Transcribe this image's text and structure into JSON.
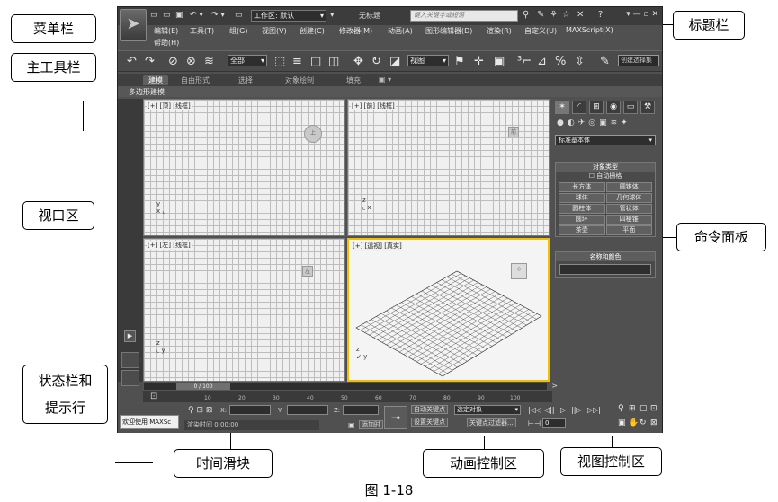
{
  "callouts": {
    "menubar": "菜单栏",
    "maintoolbar": "主工具栏",
    "viewport_area": "视口区",
    "status_line1": "状态栏和",
    "status_line2": "提示行",
    "titlebar": "标题栏",
    "command_panel": "命令面板",
    "time_slider": "时间滑块",
    "anim_controls": "动画控制区",
    "view_controls": "视图控制区"
  },
  "caption": "图 1-18",
  "titlebar": {
    "workspace": "工作区: 默认",
    "title": "无标题",
    "search_placeholder": "键入关键字或短语"
  },
  "menu": {
    "items": [
      "编辑(E)",
      "工具(T)",
      "组(G)",
      "视图(V)",
      "创建(C)",
      "修改器(M)",
      "动画(A)",
      "图形编辑器(D)",
      "渲染(R)",
      "自定义(U)",
      "MAXScript(X)"
    ],
    "help": "帮助(H)"
  },
  "toolbar": {
    "filter": "全部",
    "refcoord": "视图",
    "named_selection": "创建选择集"
  },
  "ribbon": {
    "tabs": [
      "建模",
      "自由形式",
      "选择",
      "对象绘制",
      "填充"
    ],
    "sub": "多边形建模"
  },
  "viewports": {
    "top": "[+] [顶] [线框]",
    "front": "[+] [前] [线框]",
    "left": "[+] [左] [线框]",
    "persp": "[+] [透视] [真实]"
  },
  "command_panel": {
    "dropdown": "标准基本体",
    "object_type_title": "对象类型",
    "autogrid": "☐ 自动栅格",
    "objects": [
      "长方体",
      "圆锥体",
      "球体",
      "几何球体",
      "圆柱体",
      "管状体",
      "圆环",
      "四棱锥",
      "茶壶",
      "平面"
    ],
    "name_color_title": "名称和颜色"
  },
  "timeline": {
    "slider": "0 / 100",
    "ticks": [
      "10",
      "20",
      "30",
      "40",
      "50",
      "60",
      "70",
      "80",
      "90",
      "100"
    ]
  },
  "status": {
    "welcome": "欢迎使用 MAXSc",
    "x": "X:",
    "y": "Y:",
    "z": "Z:",
    "render_time": "渲染时间 0:00:00",
    "add_time_tag": "添加时",
    "auto_key": "自动关键点",
    "set_key": "设置关键点",
    "selected": "选定对象",
    "key_filters": "关键点过滤器...",
    "frame": "0"
  }
}
